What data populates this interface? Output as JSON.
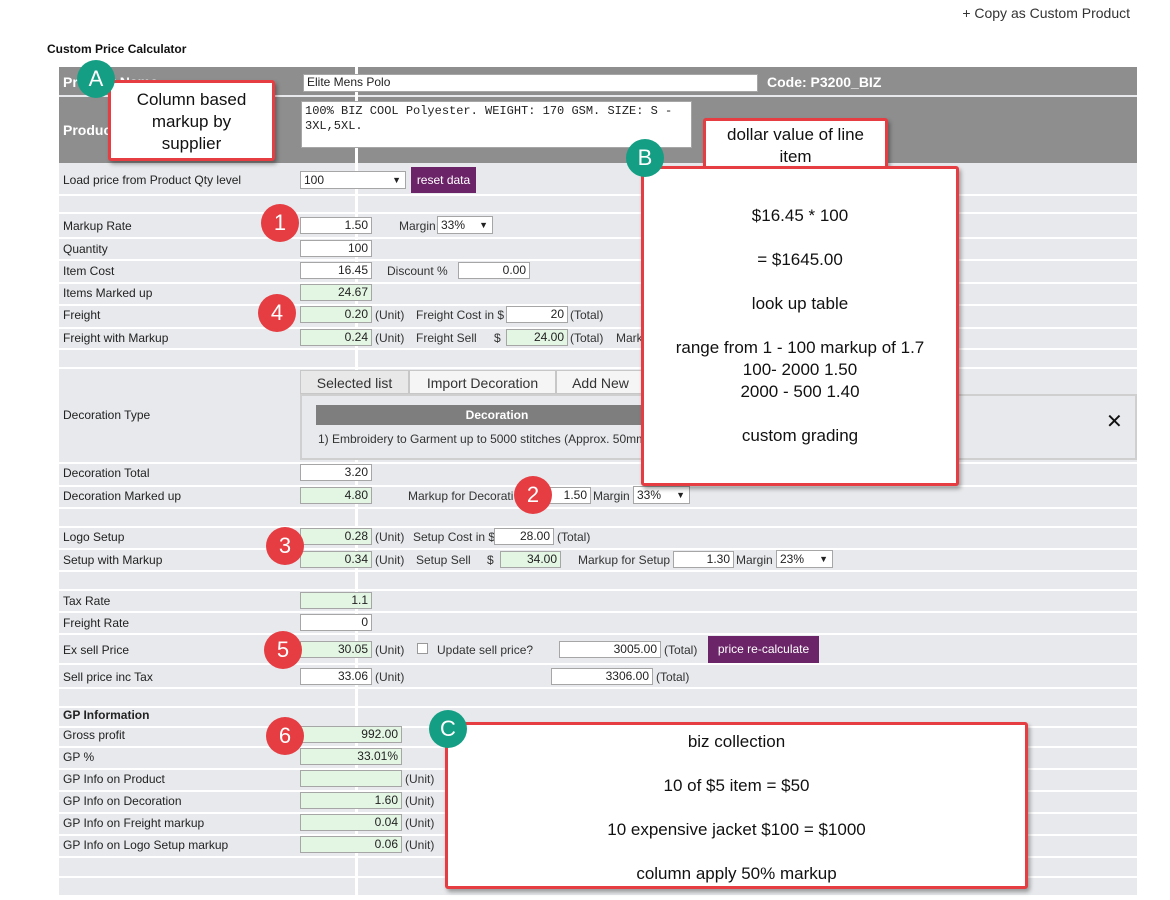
{
  "header": {
    "copy_link": "+ Copy as Custom Product",
    "title": "Custom Price Calculator"
  },
  "product": {
    "name_label": "Product Name",
    "name_value": "Elite Mens Polo",
    "code": "Code: P3200_BIZ",
    "desc_label": "Product Description",
    "desc_value": "100% BIZ COOL Polyester. WEIGHT: 170 GSM. SIZE: S - 3XL,5XL."
  },
  "load": {
    "label": "Load price from Product Qty level",
    "value": "100",
    "reset": "reset data"
  },
  "markup": {
    "label": "Markup Rate",
    "value": "1.50",
    "margin_label": "Margin",
    "margin_value": "33%"
  },
  "quantity": {
    "label": "Quantity",
    "value": "100"
  },
  "item_cost": {
    "label": "Item Cost",
    "value": "16.45",
    "discount_label": "Discount %",
    "discount_value": "0.00"
  },
  "items_marked": {
    "label": "Items Marked up",
    "value": "24.67"
  },
  "freight": {
    "label": "Freight",
    "value": "0.20",
    "unit": "(Unit)",
    "cost_label": "Freight Cost in $",
    "cost_value": "20",
    "total": "(Total)"
  },
  "freight_markup": {
    "label": "Freight with Markup",
    "value": "0.24",
    "unit": "(Unit)",
    "sell_label": "Freight Sell",
    "dollar": "$",
    "sell_value": "24.00",
    "total": "(Total)",
    "trail": "Mark"
  },
  "decoration": {
    "label": "Decoration Type",
    "tabs": [
      "Selected list",
      "Import Decoration",
      "Add New"
    ],
    "header": "Decoration",
    "item": "1) Embroidery to Garment up to 5000 stitches (Approx. 50mm",
    "close": "✕"
  },
  "deco_total": {
    "label": "Decoration Total",
    "value": "3.20"
  },
  "deco_marked": {
    "label": "Decoration Marked up",
    "value": "4.80",
    "markup_label": "Markup for Decorati",
    "markup_value": "1.50",
    "margin_label": "Margin",
    "margin_value": "33%"
  },
  "logo": {
    "label": "Logo Setup",
    "value": "0.28",
    "unit": "(Unit)",
    "cost_label": "Setup Cost in $",
    "cost_value": "28.00",
    "total": "(Total)"
  },
  "setup_markup": {
    "label": "Setup with Markup",
    "value": "0.34",
    "unit": "(Unit)",
    "sell_label": "Setup Sell",
    "dollar": "$",
    "sell_value": "34.00",
    "markup_label": "Markup for Setup",
    "markup_value": "1.30",
    "margin_label": "Margin",
    "margin_value": "23%"
  },
  "tax": {
    "label": "Tax Rate",
    "value": "1.1"
  },
  "freight_rate": {
    "label": "Freight Rate",
    "value": "0"
  },
  "ex_sell": {
    "label": "Ex sell Price",
    "value": "30.05",
    "unit": "(Unit)",
    "update_label": "Update sell price?",
    "total_value": "3005.00",
    "total": "(Total)",
    "recalc": "price re-calculate"
  },
  "sell_tax": {
    "label": "Sell price inc Tax",
    "value": "33.06",
    "unit": "(Unit)",
    "total_value": "3306.00",
    "total": "(Total)"
  },
  "gp": {
    "heading": "GP Information",
    "gross_label": "Gross profit",
    "gross_value": "992.00",
    "pct_label": "GP %",
    "pct_value": "33.01%",
    "product_label": "GP Info on Product",
    "product_value": "",
    "deco_label": "GP Info on Decoration",
    "deco_value": "1.60",
    "freight_label": "GP Info on Freight markup",
    "freight_value": "0.04",
    "logo_label": "GP Info on Logo Setup markup",
    "logo_value": "0.06",
    "unit": "(Unit)"
  },
  "annotations": {
    "badges": [
      "A",
      "B",
      "C",
      "1",
      "2",
      "3",
      "4",
      "5",
      "6"
    ],
    "a_text": [
      "Column based",
      "markup  by",
      "supplier"
    ],
    "b_title": [
      "dollar value of line",
      "item"
    ],
    "b_lines": [
      "$16.45  * 100",
      "=  $1645.00",
      "look up table",
      "range from 1 - 100 markup of 1.7",
      "100- 2000   1.50",
      "2000 - 500  1.40",
      "custom grading"
    ],
    "c_lines": [
      "biz collection",
      "10 of $5 item   = $50",
      "10 expensive  jacket  $100  =  $1000",
      "column  apply 50% markup"
    ]
  },
  "colors": {
    "accent_red": "#e53d42",
    "accent_teal": "#149f84",
    "button_purple": "#6b2468",
    "header_grey": "#8e8e8e"
  }
}
